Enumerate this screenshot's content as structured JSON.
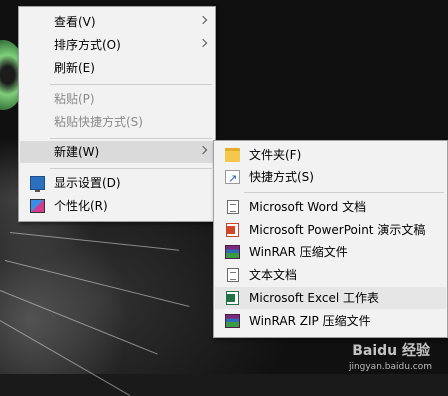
{
  "context_menu": {
    "items": [
      {
        "label": "查看(V)",
        "has_submenu": true,
        "enabled": true
      },
      {
        "label": "排序方式(O)",
        "has_submenu": true,
        "enabled": true
      },
      {
        "label": "刷新(E)",
        "has_submenu": false,
        "enabled": true
      },
      {
        "label": "粘贴(P)",
        "has_submenu": false,
        "enabled": false
      },
      {
        "label": "粘贴快捷方式(S)",
        "has_submenu": false,
        "enabled": false
      },
      {
        "label": "新建(W)",
        "has_submenu": true,
        "enabled": true,
        "highlighted": true
      },
      {
        "label": "显示设置(D)",
        "icon": "display-settings-icon",
        "enabled": true
      },
      {
        "label": "个性化(R)",
        "icon": "personalize-icon",
        "enabled": true
      }
    ]
  },
  "new_submenu": {
    "items": [
      {
        "label": "文件夹(F)",
        "icon": "folder-icon"
      },
      {
        "label": "快捷方式(S)",
        "icon": "shortcut-icon"
      },
      {
        "label": "Microsoft Word 文档",
        "icon": "word-document-icon"
      },
      {
        "label": "Microsoft PowerPoint 演示文稿",
        "icon": "powerpoint-icon"
      },
      {
        "label": "WinRAR 压缩文件",
        "icon": "winrar-icon"
      },
      {
        "label": "文本文档",
        "icon": "text-document-icon"
      },
      {
        "label": "Microsoft Excel 工作表",
        "icon": "excel-icon",
        "highlighted": true
      },
      {
        "label": "WinRAR ZIP 压缩文件",
        "icon": "winrar-zip-icon"
      }
    ]
  },
  "watermark": {
    "brand": "Baidu 经验",
    "url": "jingyan.baidu.com"
  },
  "colors": {
    "menu_background": "#f2f2f2",
    "hover_background": "#dadada",
    "disabled_text": "#8a8a8a"
  }
}
